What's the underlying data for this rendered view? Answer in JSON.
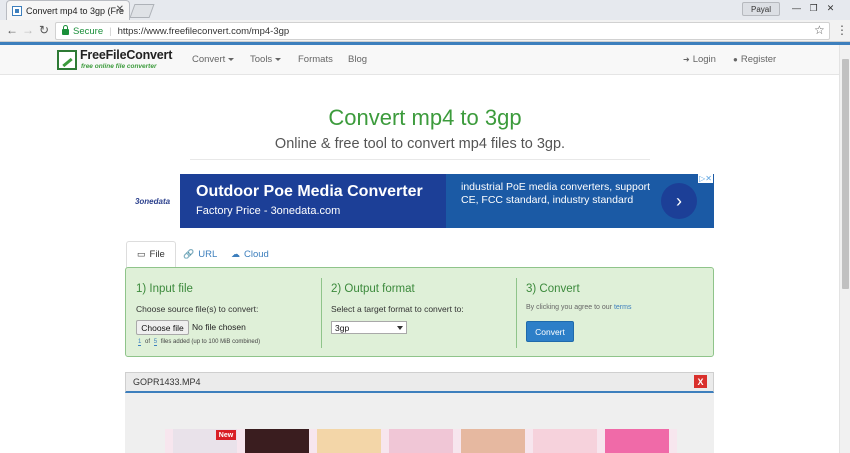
{
  "browser": {
    "tab_title": "Convert mp4 to 3gp (Fre",
    "tab_close": "✕",
    "user_name": "Payal",
    "secure_label": "Secure",
    "url": "https://www.freefileconvert.com/mp4-3gp",
    "icons": [
      "back-icon",
      "forward-icon",
      "reload-icon",
      "lock-icon",
      "star-icon",
      "menu-icon"
    ]
  },
  "site": {
    "logo_title": "FreeFileConvert",
    "logo_tagline": "free online file converter",
    "nav": {
      "convert": "Convert",
      "tools": "Tools",
      "formats": "Formats",
      "blog": "Blog",
      "login": "Login",
      "register": "Register"
    }
  },
  "page": {
    "title": "Convert mp4 to 3gp",
    "subtitle": "Online & free tool to convert mp4 files to 3gp."
  },
  "ad": {
    "brand": "3onedata",
    "title": "Outdoor Poe Media Converter",
    "subtitle": "Factory Price - 3onedata.com",
    "description": "industrial PoE media converters, support CE, FCC standard, industry standard",
    "arrow": "›"
  },
  "tabs": {
    "file": "File",
    "url": "URL",
    "cloud": "Cloud"
  },
  "step1": {
    "heading": "1) Input file",
    "label": "Choose source file(s) to convert:",
    "choose_button": "Choose file",
    "no_file": "No file chosen",
    "count_current": "1",
    "count_of": "of",
    "count_max": "5",
    "count_text": "files added (up to 100 MiB combined)"
  },
  "step2": {
    "heading": "2) Output format",
    "label": "Select a target format to convert to:",
    "selected": "3gp"
  },
  "step3": {
    "heading": "3) Convert",
    "agree_prefix": "By clicking you agree to our",
    "terms": "terms",
    "button": "Convert"
  },
  "file_row": {
    "name": "GOPR1433.MP4",
    "remove": "X"
  },
  "banner": {
    "badge": "New"
  },
  "colors": {
    "accent_green": "#3c9b3c",
    "link_blue": "#3d7fbd",
    "panel_bg": "#dff0d8",
    "danger": "#d9302c"
  }
}
